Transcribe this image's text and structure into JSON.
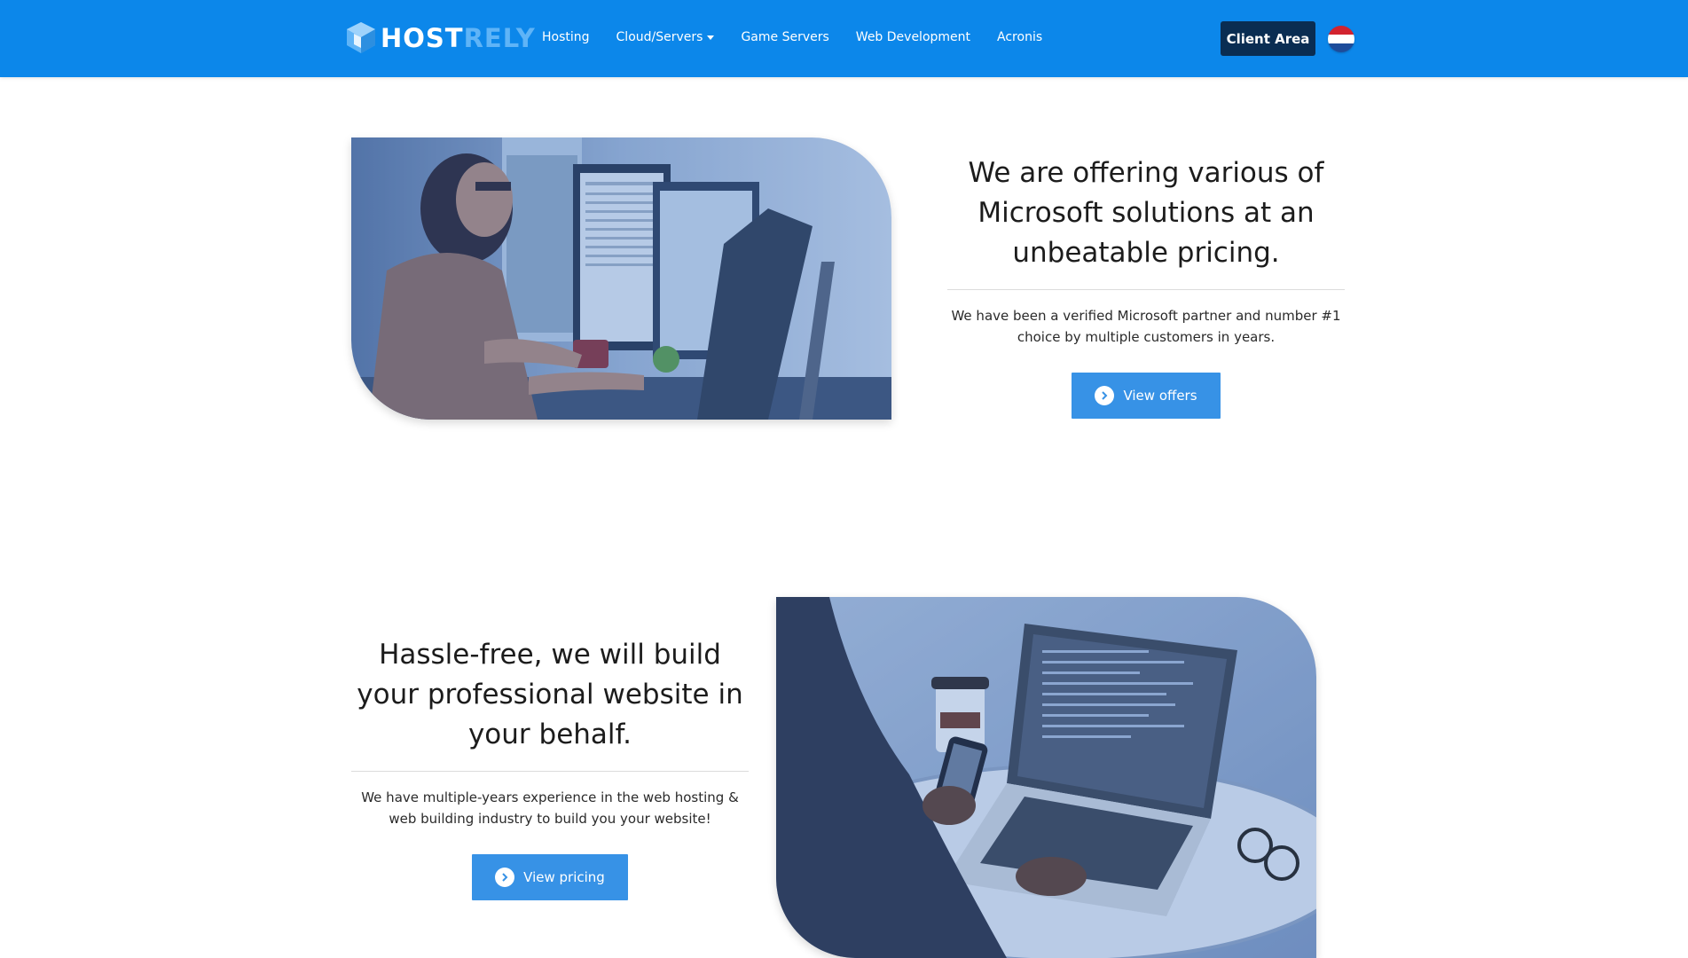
{
  "brand": {
    "part1": "HOST",
    "part2": "RELY"
  },
  "nav": {
    "items": [
      "Hosting",
      "Cloud/Servers",
      "Game Servers",
      "Web Development",
      "Acronis"
    ],
    "client_area": "Client Area",
    "language_flag": "flag-netherlands-icon"
  },
  "section1": {
    "headline": "We are offering various of Microsoft solutions at an unbeatable pricing.",
    "description": "We have been a verified Microsoft partner and number #1 choice by multiple customers in years.",
    "button": "View offers",
    "image": "woman-working-at-computer-photo"
  },
  "section2": {
    "headline": "Hassle-free, we will build your professional website in your behalf.",
    "description": "We have multiple-years experience in the web hosting & web building industry to build you your website!",
    "button": "View pricing",
    "image": "laptop-and-phone-coding-photo"
  },
  "colors": {
    "navbar": "#0c87ea",
    "client_button": "#0a2d52",
    "cta_button": "#3792e6",
    "logo_accent": "#5fb4f7"
  }
}
